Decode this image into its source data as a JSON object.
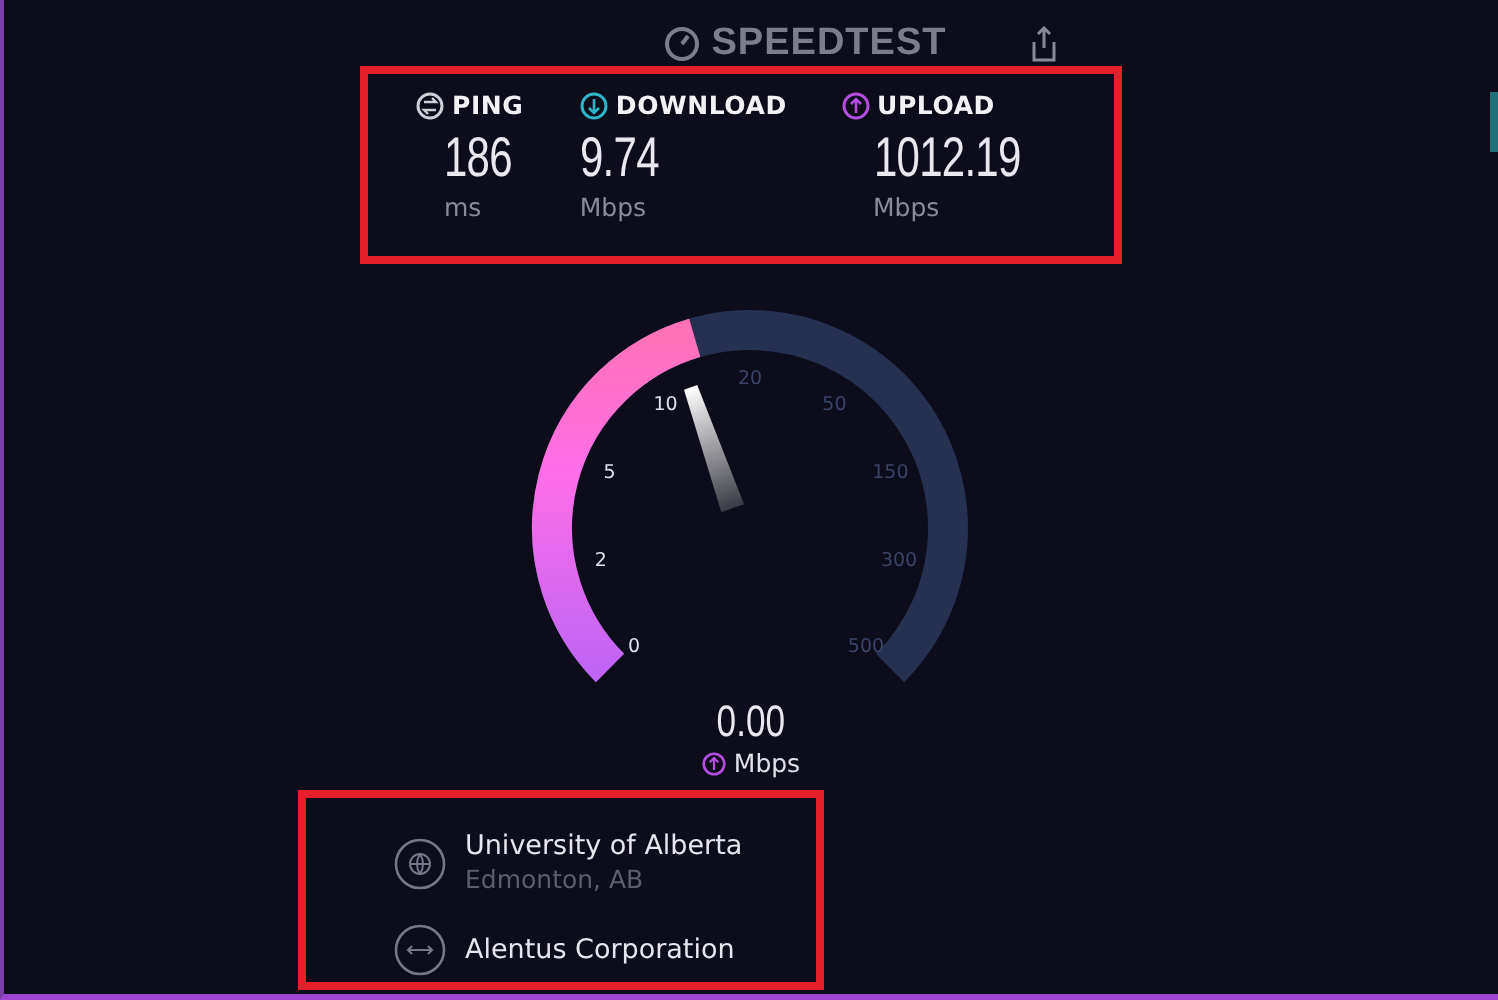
{
  "header": {
    "logo": "SPEEDTEST"
  },
  "stats": [
    {
      "kind": "ping",
      "label": "PING",
      "value": "186",
      "unit": "ms"
    },
    {
      "kind": "download",
      "label": "DOWNLOAD",
      "value": "9.74",
      "unit": "Mbps"
    },
    {
      "kind": "upload",
      "label": "UPLOAD",
      "value": "1012.19",
      "unit": "Mbps"
    }
  ],
  "gauge": {
    "ticks": [
      "0",
      "2",
      "5",
      "10",
      "20",
      "50",
      "150",
      "300",
      "500"
    ],
    "reading": "0.00",
    "unit": "Mbps"
  },
  "server": {
    "host": "University of Alberta",
    "location": "Edmonton, AB",
    "provider": "Alentus Corporation"
  }
}
